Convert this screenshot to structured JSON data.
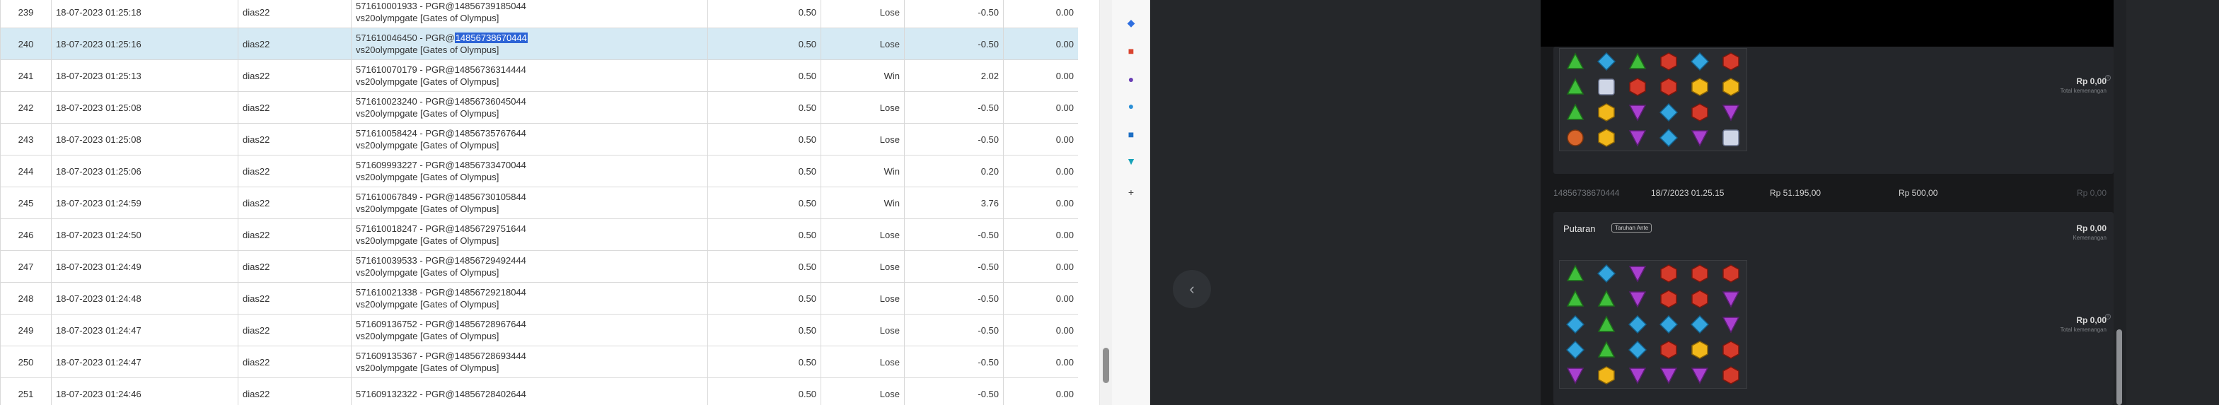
{
  "table": {
    "rows": [
      {
        "no": "239",
        "date": "18-07-2023 01:25:18",
        "user": "dias22",
        "desc1": "571610001933 - PGR@14856739185044",
        "desc1_sel": "",
        "desc2": "vs20olympgate [Gates of Olympus]",
        "bet": "0.50",
        "result": "Lose",
        "win": "-0.50",
        "jp": "0.00"
      },
      {
        "no": "240",
        "date": "18-07-2023 01:25:16",
        "user": "dias22",
        "desc1": "571610046450 - PGR@",
        "desc1_sel": "14856738670444",
        "desc2": "vs20olympgate [Gates of Olympus]",
        "bet": "0.50",
        "result": "Lose",
        "win": "-0.50",
        "jp": "0.00",
        "selected": true
      },
      {
        "no": "241",
        "date": "18-07-2023 01:25:13",
        "user": "dias22",
        "desc1": "571610070179 - PGR@14856736314444",
        "desc1_sel": "",
        "desc2": "vs20olympgate [Gates of Olympus]",
        "bet": "0.50",
        "result": "Win",
        "win": "2.02",
        "jp": "0.00"
      },
      {
        "no": "242",
        "date": "18-07-2023 01:25:08",
        "user": "dias22",
        "desc1": "571610023240 - PGR@14856736045044",
        "desc1_sel": "",
        "desc2": "vs20olympgate [Gates of Olympus]",
        "bet": "0.50",
        "result": "Lose",
        "win": "-0.50",
        "jp": "0.00"
      },
      {
        "no": "243",
        "date": "18-07-2023 01:25:08",
        "user": "dias22",
        "desc1": "571610058424 - PGR@14856735767644",
        "desc1_sel": "",
        "desc2": "vs20olympgate [Gates of Olympus]",
        "bet": "0.50",
        "result": "Lose",
        "win": "-0.50",
        "jp": "0.00"
      },
      {
        "no": "244",
        "date": "18-07-2023 01:25:06",
        "user": "dias22",
        "desc1": "571609993227 - PGR@14856733470044",
        "desc1_sel": "",
        "desc2": "vs20olympgate [Gates of Olympus]",
        "bet": "0.50",
        "result": "Win",
        "win": "0.20",
        "jp": "0.00"
      },
      {
        "no": "245",
        "date": "18-07-2023 01:24:59",
        "user": "dias22",
        "desc1": "571610067849 - PGR@14856730105844",
        "desc1_sel": "",
        "desc2": "vs20olympgate [Gates of Olympus]",
        "bet": "0.50",
        "result": "Win",
        "win": "3.76",
        "jp": "0.00"
      },
      {
        "no": "246",
        "date": "18-07-2023 01:24:50",
        "user": "dias22",
        "desc1": "571610018247 - PGR@14856729751644",
        "desc1_sel": "",
        "desc2": "vs20olympgate [Gates of Olympus]",
        "bet": "0.50",
        "result": "Lose",
        "win": "-0.50",
        "jp": "0.00"
      },
      {
        "no": "247",
        "date": "18-07-2023 01:24:49",
        "user": "dias22",
        "desc1": "571610039533 - PGR@14856729492444",
        "desc1_sel": "",
        "desc2": "vs20olympgate [Gates of Olympus]",
        "bet": "0.50",
        "result": "Lose",
        "win": "-0.50",
        "jp": "0.00"
      },
      {
        "no": "248",
        "date": "18-07-2023 01:24:48",
        "user": "dias22",
        "desc1": "571610021338 - PGR@14856729218044",
        "desc1_sel": "",
        "desc2": "vs20olympgate [Gates of Olympus]",
        "bet": "0.50",
        "result": "Lose",
        "win": "-0.50",
        "jp": "0.00"
      },
      {
        "no": "249",
        "date": "18-07-2023 01:24:47",
        "user": "dias22",
        "desc1": "571609136752 - PGR@14856728967644",
        "desc1_sel": "",
        "desc2": "vs20olympgate [Gates of Olympus]",
        "bet": "0.50",
        "result": "Lose",
        "win": "-0.50",
        "jp": "0.00"
      },
      {
        "no": "250",
        "date": "18-07-2023 01:24:47",
        "user": "dias22",
        "desc1": "571609135367 - PGR@14856728693444",
        "desc1_sel": "",
        "desc2": "vs20olympgate [Gates of Olympus]",
        "bet": "0.50",
        "result": "Lose",
        "win": "-0.50",
        "jp": "0.00"
      },
      {
        "no": "251",
        "date": "18-07-2023 01:24:46",
        "user": "dias22",
        "desc1": "571609132322 - PGR@14856728402644",
        "desc1_sel": "",
        "desc2": "",
        "bet": "0.50",
        "result": "Lose",
        "win": "-0.50",
        "jp": "0.00"
      }
    ]
  },
  "icons": [
    {
      "name": "tag-icon",
      "glyph": "◆",
      "color": "#2f6fe0"
    },
    {
      "name": "toolbox-icon",
      "glyph": "■",
      "color": "#d9442f"
    },
    {
      "name": "people-icon",
      "glyph": "●",
      "color": "#6a3fb5"
    },
    {
      "name": "copilot-icon",
      "glyph": "●",
      "color": "#2b8fd6"
    },
    {
      "name": "outlook-icon",
      "glyph": "■",
      "color": "#1f6fc4"
    },
    {
      "name": "shopping-cart-icon",
      "glyph": "▼",
      "color": "#17a2b8"
    },
    {
      "name": "add-icon",
      "glyph": "+",
      "color": "#444444"
    }
  ],
  "game": {
    "top_card": {
      "amount": "Rp 0,00",
      "amount_label": "Total kemenangan"
    },
    "summary": {
      "round_id": "14856738670444",
      "datetime": "18/7/2023 01.25.15",
      "balance": "Rp 51.195,00",
      "bet": "Rp 500,00",
      "win": "Rp 0,00"
    },
    "bottom_card": {
      "title": "Putaran",
      "badge": "Taruhan Ante",
      "amount_top": "Rp 0,00",
      "amount_top_label": "Kemenangan",
      "amount": "Rp 0,00",
      "amount_label": "Total kemenangan"
    },
    "grid_top": [
      [
        "green",
        "blue",
        "green",
        "red",
        "blue",
        "red"
      ],
      [
        "green",
        "zeus",
        "red",
        "red",
        "yellow",
        "yellow"
      ],
      [
        "green",
        "yellow",
        "purple",
        "blue",
        "red",
        "purple"
      ],
      [
        "orange",
        "yellow",
        "purple",
        "blue",
        "purple",
        "zeus"
      ]
    ],
    "grid_bottom": [
      [
        "green",
        "blue",
        "purple",
        "red",
        "red",
        "red"
      ],
      [
        "green",
        "green",
        "purple",
        "red",
        "red",
        "purple"
      ],
      [
        "blue",
        "green",
        "blue",
        "blue",
        "blue",
        "purple"
      ],
      [
        "blue",
        "green",
        "blue",
        "red",
        "yellow",
        "red"
      ],
      [
        "purple",
        "yellow",
        "purple",
        "purple",
        "purple",
        "red"
      ]
    ]
  }
}
